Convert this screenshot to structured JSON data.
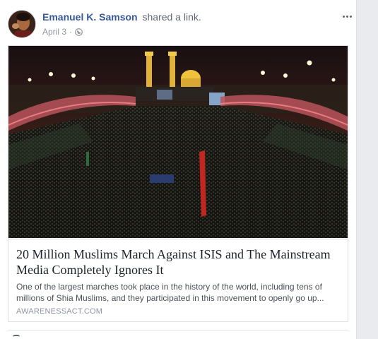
{
  "post": {
    "author_name": "Emanuel K. Samson",
    "action_text": "shared a link.",
    "date": "April 3",
    "separator": "·",
    "privacy_icon": "globe-icon",
    "more_icon": "more-options-icon"
  },
  "link": {
    "title": "20 Million Muslims March Against ISIS and The Mainstream Media Completely Ignores It",
    "description": "One of the largest marches took place in the history of the world, including tens of millions of Shia Muslims, and they participated in this movement to openly go up...",
    "domain": "AWARENESSACT.COM",
    "image_alt": "crowd-at-night-shrine-photo"
  },
  "colors": {
    "author": "#365899",
    "muted": "#90949c",
    "title": "#1d2129",
    "card_border": "#dddfe2"
  }
}
